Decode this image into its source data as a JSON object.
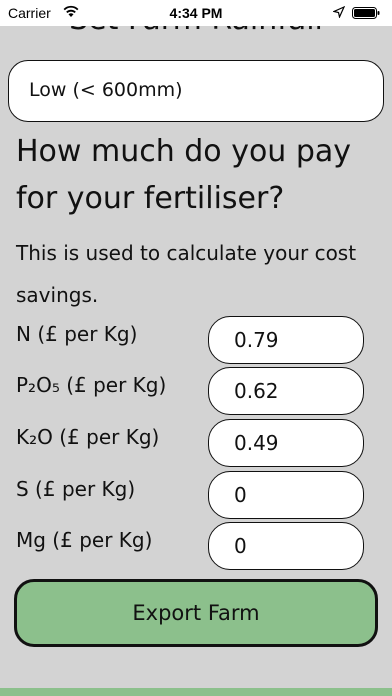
{
  "status_bar": {
    "carrier": "Carrier",
    "time": "4:34 PM"
  },
  "rainfall": {
    "heading": "Set Farm Rainfall",
    "selected_value": "Low (< 600mm)"
  },
  "fertiliser": {
    "question": "How much do you pay for your fertiliser?",
    "hint": "This is used to calculate your cost savings.",
    "prices": [
      {
        "label": "N (£ per Kg)",
        "value": "0.79"
      },
      {
        "label": "P₂O₅ (£ per Kg)",
        "value": "0.62"
      },
      {
        "label": "K₂O (£ per Kg)",
        "value": "0.49"
      },
      {
        "label": "S (£ per Kg)",
        "value": "0"
      },
      {
        "label": "Mg (£ per Kg)",
        "value": "0"
      }
    ]
  },
  "actions": {
    "export_label": "Export Farm"
  },
  "colors": {
    "background": "#d3d3d3",
    "accent_green": "#8cc08c",
    "field_background": "#ffffff"
  }
}
